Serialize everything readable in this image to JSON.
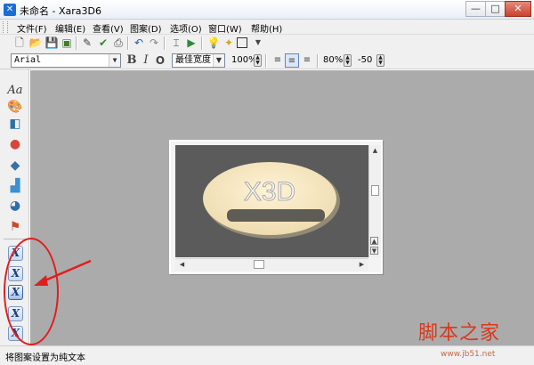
{
  "window": {
    "icon": "xara-app-icon",
    "title": "未命名 - Xara3D6",
    "controls": {
      "minimize": "—",
      "maximize": "□",
      "close": "✕"
    }
  },
  "menu": {
    "items": [
      "文件(F)",
      "编辑(E)",
      "查看(V)",
      "图案(D)",
      "选项(O)",
      "窗口(W)",
      "帮助(H)"
    ]
  },
  "toolbar1": {
    "icons": [
      "new-document-icon",
      "open-folder-icon",
      "save-icon",
      "export-icon",
      "edit-icon",
      "check-icon",
      "print-icon",
      "undo-icon",
      "redo-icon",
      "text-cursor-icon",
      "play-icon",
      "lightbulb-icon",
      "magic-wand-icon",
      "frame-icon",
      "dropdown-arrow-icon"
    ]
  },
  "toolbar2": {
    "font_name": "Arial",
    "bold": "B",
    "italic": "I",
    "outline": "O",
    "width_mode": "最佳宽度",
    "zoom": "100%",
    "spacing_percent": "80%",
    "offset": "-50"
  },
  "left_toolbar": {
    "text_tool_label": "Aa",
    "icons": [
      "text-icon",
      "palette-icon",
      "extrude-cube-icon",
      "sphere-icon",
      "diamond-icon",
      "shapes-icon",
      "globe-icon",
      "lamp-icon"
    ],
    "x_buttons": [
      "X",
      "X",
      "X",
      "X",
      "X"
    ]
  },
  "canvas": {
    "text_3d": "X3D",
    "background_color": "#5b5b5b",
    "ellipse_color": "#f5e6c3"
  },
  "status": {
    "text": "将图案设置为纯文本"
  },
  "watermark": {
    "text": "脚本之家",
    "url": "www.jb51.net"
  },
  "colors": {
    "workspace": "#ababab",
    "annotation": "#e01e1e",
    "chrome": "#f0f0f0"
  }
}
